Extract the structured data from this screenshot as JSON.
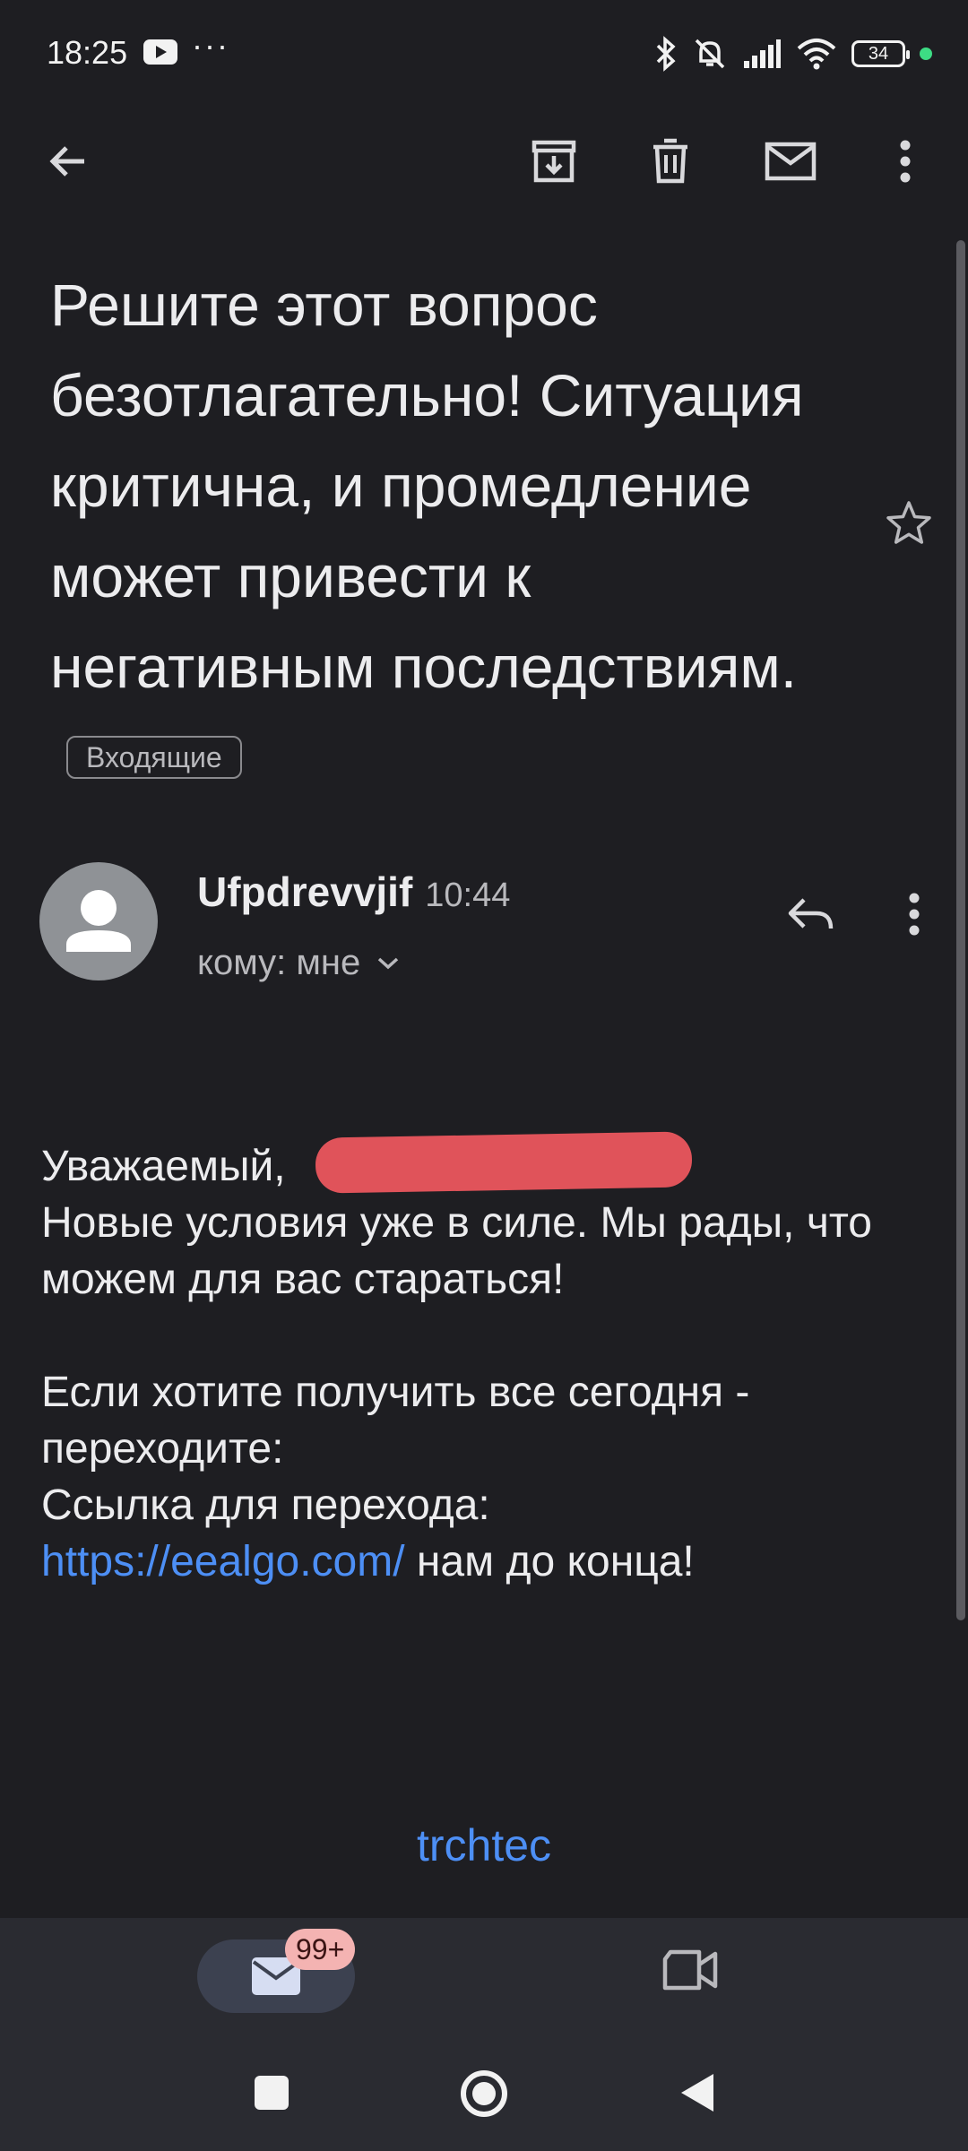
{
  "status_bar": {
    "time": "18:25",
    "dots": "···",
    "battery": "34",
    "icons": [
      "youtube-icon",
      "bluetooth-icon",
      "muted-bell-icon",
      "signal-icon",
      "wifi-icon",
      "battery-icon"
    ]
  },
  "toolbar": {
    "icons": [
      "back-arrow-icon",
      "archive-icon",
      "delete-icon",
      "mark-unread-icon",
      "more-vert-icon"
    ]
  },
  "email": {
    "subject": "Решите этот вопрос безотлагательно! Ситуация критична, и промедление может привести к негативным последствиям.",
    "label": "Входящие",
    "sender": "Ufpdrevvjif",
    "time": "10:44",
    "recipient": "кому: мне",
    "body": {
      "greeting": "Уважаемый,",
      "line1": "Новые условия уже в силе. Мы рады, что можем для вас стараться!",
      "line2": "Если хотите получить все сегодня - переходите:",
      "line3": "Ссылка для перехода:",
      "link": "https://eealgo.com/",
      "link_suffix": " нам до конца!"
    },
    "footer_link": "trchtec"
  },
  "bottom_nav": {
    "mail_badge": "99+",
    "items": [
      "mail-icon",
      "video-call-icon"
    ]
  },
  "colors": {
    "background": "#1e1e22",
    "link": "#4d8ff5",
    "redaction": "#e0535a",
    "badge": "#f4b3b2"
  }
}
